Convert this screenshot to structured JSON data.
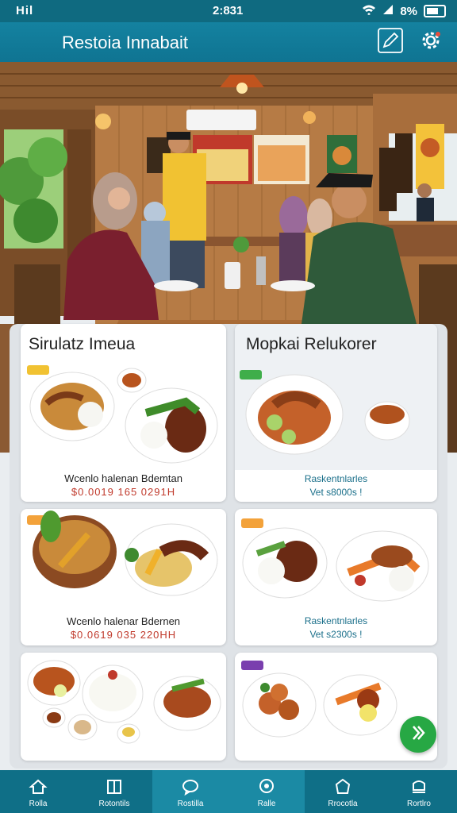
{
  "status_bar": {
    "left": "Hil",
    "time": "2:831",
    "battery": "8%"
  },
  "app_bar": {
    "title": "Restoia Innabait",
    "edit_icon": "edit-icon",
    "settings_icon": "gear-icon"
  },
  "colors": {
    "primary": "#0f7492",
    "bottom_nav": "#0f6f87",
    "price_red": "#c0392b",
    "price_teal": "#1a6f8a",
    "fab_green": "#27a844"
  },
  "hero": {
    "description_icon": "restaurant-photo"
  },
  "cards": {
    "left_top": {
      "title": "Sirulatz Imeua",
      "badge": "",
      "caption": "Wcenlo halenan Bdemtan",
      "price": "$0.0019  165  0291H"
    },
    "right_top": {
      "title": "Mopkai Relukorer",
      "badge": "",
      "caption": "Raskentnlarles",
      "price": "Vet s8000s !"
    },
    "left_mid": {
      "badge": "",
      "caption": "Wcenlo halenar Bdernen",
      "price": "$0.0619  035  220HH"
    },
    "right_mid": {
      "badge": "",
      "caption": "Raskentnlarles",
      "price": "Vet s2300s !"
    },
    "left_bottom": {
      "badge": ""
    },
    "right_bottom": {
      "badge": ""
    }
  },
  "fab": {
    "icon": "chevron-right-icon"
  },
  "bottom_nav": [
    {
      "label": "Rolla",
      "icon": "home-icon"
    },
    {
      "label": "Rotontils",
      "icon": "menu-book-icon"
    },
    {
      "label": "Rostilla",
      "icon": "chat-icon"
    },
    {
      "label": "Ralle",
      "icon": "search-icon"
    },
    {
      "label": "Rrocotla",
      "icon": "bag-icon"
    },
    {
      "label": "Rortlro",
      "icon": "cart-icon"
    }
  ]
}
